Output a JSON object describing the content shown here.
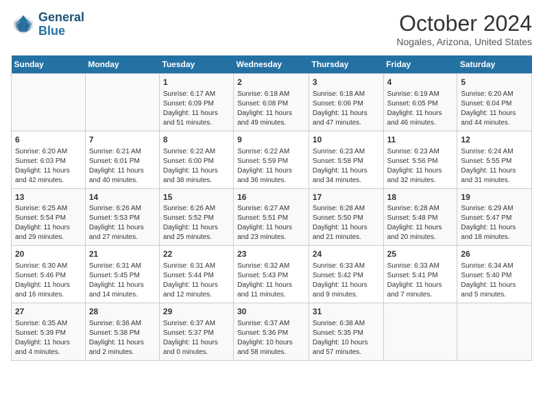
{
  "logo": {
    "line1": "General",
    "line2": "Blue"
  },
  "title": "October 2024",
  "location": "Nogales, Arizona, United States",
  "days_of_week": [
    "Sunday",
    "Monday",
    "Tuesday",
    "Wednesday",
    "Thursday",
    "Friday",
    "Saturday"
  ],
  "weeks": [
    [
      {
        "day": "",
        "content": ""
      },
      {
        "day": "",
        "content": ""
      },
      {
        "day": "1",
        "content": "Sunrise: 6:17 AM\nSunset: 6:09 PM\nDaylight: 11 hours and 51 minutes."
      },
      {
        "day": "2",
        "content": "Sunrise: 6:18 AM\nSunset: 6:08 PM\nDaylight: 11 hours and 49 minutes."
      },
      {
        "day": "3",
        "content": "Sunrise: 6:18 AM\nSunset: 6:06 PM\nDaylight: 11 hours and 47 minutes."
      },
      {
        "day": "4",
        "content": "Sunrise: 6:19 AM\nSunset: 6:05 PM\nDaylight: 11 hours and 46 minutes."
      },
      {
        "day": "5",
        "content": "Sunrise: 6:20 AM\nSunset: 6:04 PM\nDaylight: 11 hours and 44 minutes."
      }
    ],
    [
      {
        "day": "6",
        "content": "Sunrise: 6:20 AM\nSunset: 6:03 PM\nDaylight: 11 hours and 42 minutes."
      },
      {
        "day": "7",
        "content": "Sunrise: 6:21 AM\nSunset: 6:01 PM\nDaylight: 11 hours and 40 minutes."
      },
      {
        "day": "8",
        "content": "Sunrise: 6:22 AM\nSunset: 6:00 PM\nDaylight: 11 hours and 38 minutes."
      },
      {
        "day": "9",
        "content": "Sunrise: 6:22 AM\nSunset: 5:59 PM\nDaylight: 11 hours and 36 minutes."
      },
      {
        "day": "10",
        "content": "Sunrise: 6:23 AM\nSunset: 5:58 PM\nDaylight: 11 hours and 34 minutes."
      },
      {
        "day": "11",
        "content": "Sunrise: 6:23 AM\nSunset: 5:56 PM\nDaylight: 11 hours and 32 minutes."
      },
      {
        "day": "12",
        "content": "Sunrise: 6:24 AM\nSunset: 5:55 PM\nDaylight: 11 hours and 31 minutes."
      }
    ],
    [
      {
        "day": "13",
        "content": "Sunrise: 6:25 AM\nSunset: 5:54 PM\nDaylight: 11 hours and 29 minutes."
      },
      {
        "day": "14",
        "content": "Sunrise: 6:26 AM\nSunset: 5:53 PM\nDaylight: 11 hours and 27 minutes."
      },
      {
        "day": "15",
        "content": "Sunrise: 6:26 AM\nSunset: 5:52 PM\nDaylight: 11 hours and 25 minutes."
      },
      {
        "day": "16",
        "content": "Sunrise: 6:27 AM\nSunset: 5:51 PM\nDaylight: 11 hours and 23 minutes."
      },
      {
        "day": "17",
        "content": "Sunrise: 6:28 AM\nSunset: 5:50 PM\nDaylight: 11 hours and 21 minutes."
      },
      {
        "day": "18",
        "content": "Sunrise: 6:28 AM\nSunset: 5:48 PM\nDaylight: 11 hours and 20 minutes."
      },
      {
        "day": "19",
        "content": "Sunrise: 6:29 AM\nSunset: 5:47 PM\nDaylight: 11 hours and 18 minutes."
      }
    ],
    [
      {
        "day": "20",
        "content": "Sunrise: 6:30 AM\nSunset: 5:46 PM\nDaylight: 11 hours and 16 minutes."
      },
      {
        "day": "21",
        "content": "Sunrise: 6:31 AM\nSunset: 5:45 PM\nDaylight: 11 hours and 14 minutes."
      },
      {
        "day": "22",
        "content": "Sunrise: 6:31 AM\nSunset: 5:44 PM\nDaylight: 11 hours and 12 minutes."
      },
      {
        "day": "23",
        "content": "Sunrise: 6:32 AM\nSunset: 5:43 PM\nDaylight: 11 hours and 11 minutes."
      },
      {
        "day": "24",
        "content": "Sunrise: 6:33 AM\nSunset: 5:42 PM\nDaylight: 11 hours and 9 minutes."
      },
      {
        "day": "25",
        "content": "Sunrise: 6:33 AM\nSunset: 5:41 PM\nDaylight: 11 hours and 7 minutes."
      },
      {
        "day": "26",
        "content": "Sunrise: 6:34 AM\nSunset: 5:40 PM\nDaylight: 11 hours and 5 minutes."
      }
    ],
    [
      {
        "day": "27",
        "content": "Sunrise: 6:35 AM\nSunset: 5:39 PM\nDaylight: 11 hours and 4 minutes."
      },
      {
        "day": "28",
        "content": "Sunrise: 6:36 AM\nSunset: 5:38 PM\nDaylight: 11 hours and 2 minutes."
      },
      {
        "day": "29",
        "content": "Sunrise: 6:37 AM\nSunset: 5:37 PM\nDaylight: 11 hours and 0 minutes."
      },
      {
        "day": "30",
        "content": "Sunrise: 6:37 AM\nSunset: 5:36 PM\nDaylight: 10 hours and 58 minutes."
      },
      {
        "day": "31",
        "content": "Sunrise: 6:38 AM\nSunset: 5:35 PM\nDaylight: 10 hours and 57 minutes."
      },
      {
        "day": "",
        "content": ""
      },
      {
        "day": "",
        "content": ""
      }
    ]
  ]
}
